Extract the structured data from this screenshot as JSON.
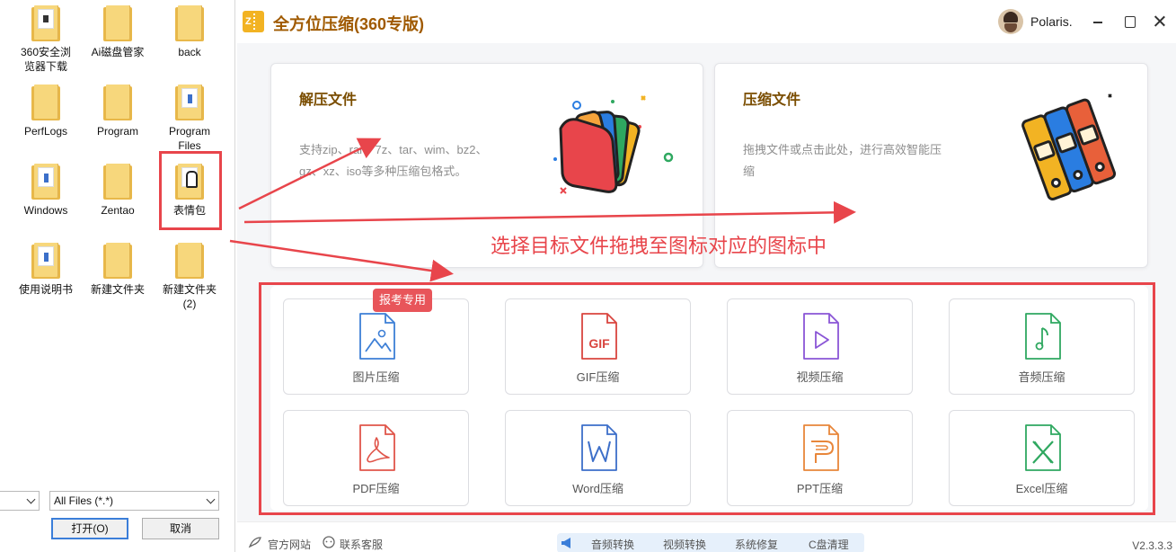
{
  "dialog": {
    "files": [
      {
        "label": "360安全浏览器下载"
      },
      {
        "label": "Ai磁盘管家"
      },
      {
        "label": "back"
      },
      {
        "label": "PerfLogs"
      },
      {
        "label": "Program"
      },
      {
        "label": "Program Files"
      },
      {
        "label": "Windows"
      },
      {
        "label": "Zentao"
      },
      {
        "label": "表情包"
      },
      {
        "label": "使用说明书"
      },
      {
        "label": "新建文件夹"
      },
      {
        "label": "新建文件夹 (2)"
      }
    ],
    "filetype_value": "All Files (*.*)",
    "open_label": "打开(O)",
    "cancel_label": "取消"
  },
  "app": {
    "title": "全方位压缩(360专版)",
    "logo_letter": "Z",
    "username": "Polaris.",
    "decompress": {
      "title": "解压文件",
      "desc_line1": "支持zip、rar、7z、tar、wim、bz2、",
      "desc_line2": "gz、xz、iso等多种压缩包格式。"
    },
    "compress": {
      "title": "压缩文件",
      "desc_line1": "拖拽文件或点击此处，进行高效智能压",
      "desc_line2": "缩"
    },
    "badge": "报考专用",
    "tools": [
      {
        "label": "图片压缩",
        "icon": "image-file-icon",
        "color": "#3d7fd6"
      },
      {
        "label": "GIF压缩",
        "icon": "gif-file-icon",
        "color": "#d9453f"
      },
      {
        "label": "视频压缩",
        "icon": "video-file-icon",
        "color": "#8a55d6"
      },
      {
        "label": "音频压缩",
        "icon": "audio-file-icon",
        "color": "#2fa860"
      },
      {
        "label": "PDF压缩",
        "icon": "pdf-file-icon",
        "color": "#e0554a"
      },
      {
        "label": "Word压缩",
        "icon": "word-file-icon",
        "color": "#3d6fc9"
      },
      {
        "label": "PPT压缩",
        "icon": "ppt-file-icon",
        "color": "#e8863a"
      },
      {
        "label": "Excel压缩",
        "icon": "excel-file-icon",
        "color": "#2fa860"
      }
    ],
    "gif_text": "GIF",
    "statusbar": {
      "website": "官方网站",
      "support": "联系客服",
      "shortcuts": [
        "音频转换",
        "视频转换",
        "系统修复",
        "C盘清理"
      ],
      "version": "V2.3.3.3"
    }
  },
  "annotation": "选择目标文件拖拽至图标对应的图标中",
  "colors": {
    "accent_red": "#e8454b",
    "title_brown": "#a05a00"
  }
}
